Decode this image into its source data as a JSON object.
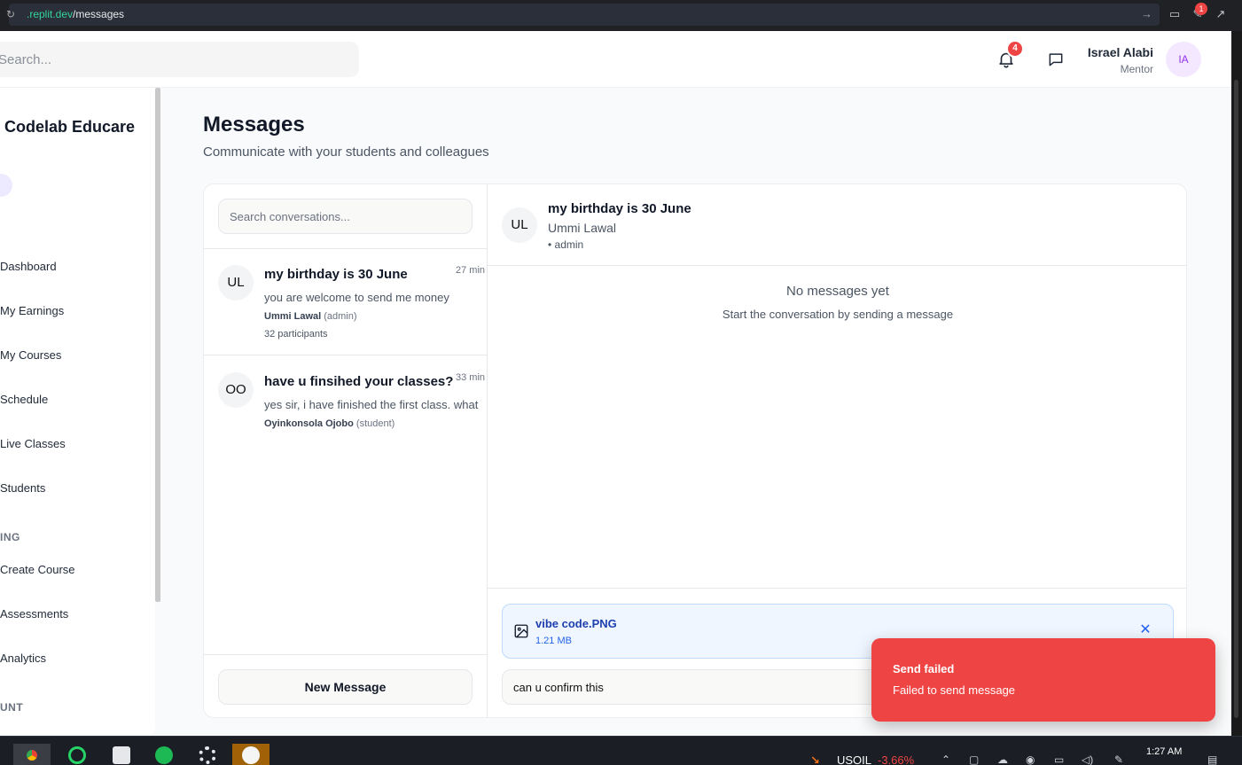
{
  "browser": {
    "url_host": ".replit.dev",
    "url_path": "/messages",
    "notification_count": "1"
  },
  "header": {
    "search_placeholder": "Search...",
    "notification_count": "4",
    "user_name": "Israel Alabi",
    "user_role": "Mentor",
    "user_initials": "IA"
  },
  "sidebar": {
    "brand": "Codelab Educare",
    "items": [
      {
        "label": "Dashboard"
      },
      {
        "label": "My Earnings"
      },
      {
        "label": "My Courses"
      },
      {
        "label": "Schedule"
      },
      {
        "label": "Live Classes"
      },
      {
        "label": "Students"
      }
    ],
    "section_teaching": "ING",
    "teaching_items": [
      {
        "label": "Create Course"
      },
      {
        "label": "Assessments"
      },
      {
        "label": "Analytics"
      }
    ],
    "section_account": "UNT"
  },
  "page": {
    "title": "Messages",
    "subtitle": "Communicate with your students and colleagues"
  },
  "conversations": {
    "search_placeholder": "Search conversations...",
    "items": [
      {
        "initials": "UL",
        "title": "my birthday is 30 June",
        "time": "27 min",
        "preview": "you are welcome to send me money",
        "sender": "Ummi Lawal",
        "sender_role": "(admin)",
        "participants": "32 participants"
      },
      {
        "initials": "OO",
        "title": "have u finsihed your classes?",
        "time": "33 min",
        "preview": "yes sir, i have finished the first class. what",
        "sender": "Oyinkonsola Ojobo",
        "sender_role": "(student)"
      }
    ],
    "new_message_label": "New Message"
  },
  "chat": {
    "initials": "UL",
    "title": "my birthday is 30 June",
    "member": "Ummi Lawal",
    "role": "• admin",
    "empty_title": "No messages yet",
    "empty_subtitle": "Start the conversation by sending a message",
    "attachment": {
      "name": "vibe code.PNG",
      "size": "1.21 MB"
    },
    "compose_value": "can u confirm this"
  },
  "toast": {
    "title": "Send failed",
    "message": "Failed to send message"
  },
  "taskbar": {
    "ticker_name": "USOIL",
    "ticker_value": "-3.66%",
    "clock": "1:27 AM"
  },
  "colors": {
    "accent_error": "#ef4444",
    "attachment_blue": "#2563eb",
    "avatar_purple": "#9333ea"
  }
}
